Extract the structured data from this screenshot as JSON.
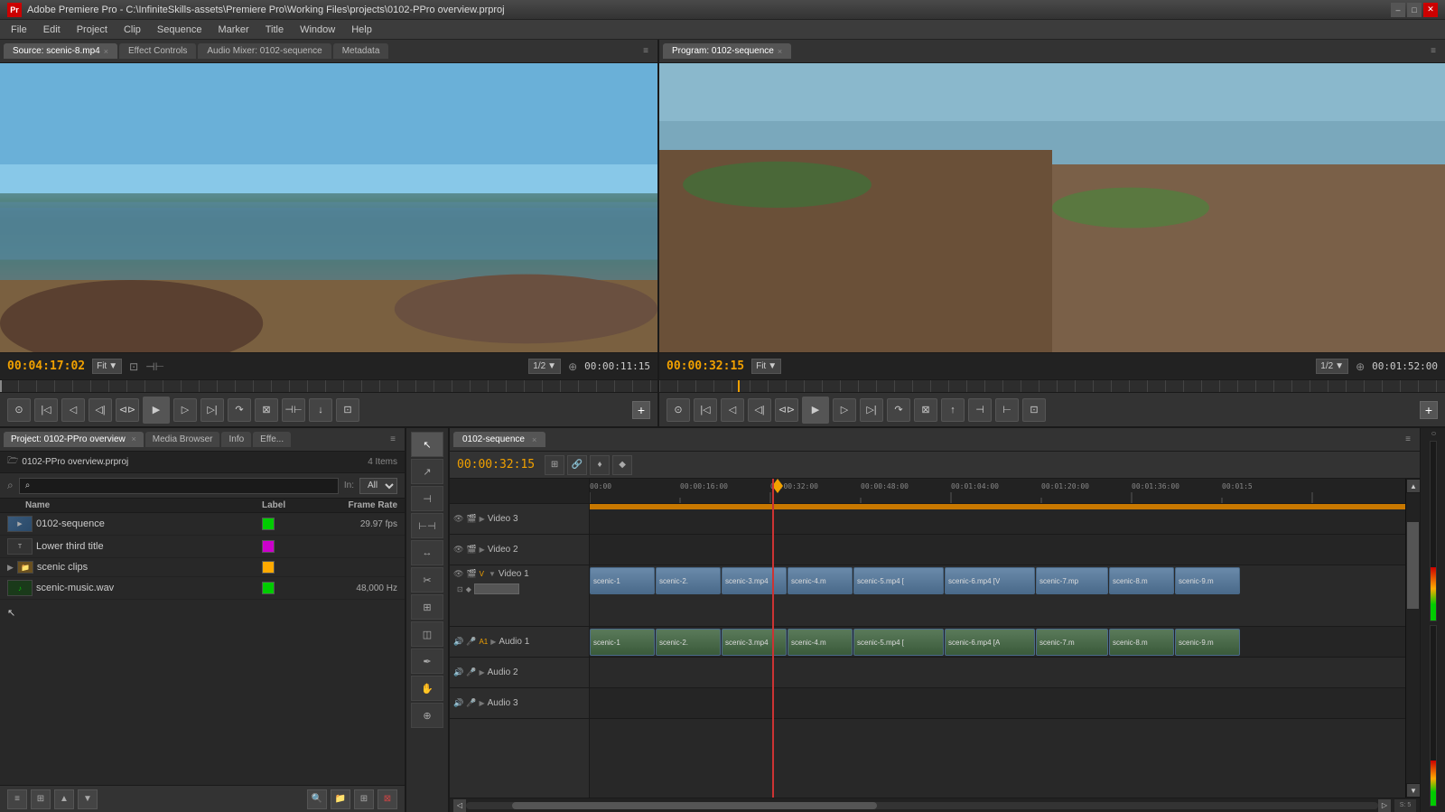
{
  "title_bar": {
    "title": "Adobe Premiere Pro - C:\\InfiniteSkills-assets\\Premiere Pro\\Working Files\\projects\\0102-PPro overview.prproj",
    "logo": "Pr",
    "minimize": "–",
    "maximize": "□",
    "close": "✕"
  },
  "menu_bar": {
    "items": [
      "File",
      "Edit",
      "Project",
      "Clip",
      "Sequence",
      "Marker",
      "Title",
      "Window",
      "Help"
    ]
  },
  "source_panel": {
    "tabs": [
      {
        "label": "Source: scenic-8.mp4",
        "active": true,
        "closable": true
      },
      {
        "label": "Effect Controls",
        "active": false
      },
      {
        "label": "Audio Mixer: 0102-sequence",
        "active": false
      },
      {
        "label": "Metadata",
        "active": false
      }
    ],
    "menu_btn": "≡",
    "timecode": "00:04:17:02",
    "fit_label": "Fit",
    "scale": "1/2",
    "timecode_right": "00:00:11:15"
  },
  "program_panel": {
    "tabs": [
      {
        "label": "Program: 0102-sequence",
        "active": true,
        "closable": true
      }
    ],
    "menu_btn": "≡",
    "timecode": "00:00:32:15",
    "fit_label": "Fit",
    "scale": "1/2",
    "timecode_right": "00:01:52:00"
  },
  "transport_source": {
    "buttons": [
      "⊲",
      "◁",
      "|◁",
      "◁|",
      "▶",
      "|▷",
      "▷|",
      "▷⊳",
      "⊳"
    ],
    "extra_left": "⊙",
    "marker": "♦",
    "camera": "⊡"
  },
  "transport_program": {
    "buttons": [
      "⊲",
      "◁",
      "|◁",
      "◁|",
      "▶",
      "|▷",
      "▷|",
      "▷⊳",
      "⊳"
    ],
    "extra_left": "⊙",
    "marker": "♦",
    "camera": "⊡"
  },
  "project_panel": {
    "tabs": [
      {
        "label": "Project: 0102-PPro overview",
        "active": true,
        "closable": true
      },
      {
        "label": "Media Browser",
        "active": false
      },
      {
        "label": "Info",
        "active": false
      },
      {
        "label": "Effe...",
        "active": false
      }
    ],
    "project_name": "0102-PPro overview.prproj",
    "item_count": "4 Items",
    "search_placeholder": "⌕",
    "in_label": "In:",
    "in_value": "All",
    "columns": {
      "name": "Name",
      "label": "Label",
      "frame_rate": "Frame Rate"
    },
    "items": [
      {
        "type": "sequence",
        "name": "0102-sequence",
        "label_color": "#00cc00",
        "frame_rate": "29.97 fps",
        "icon": "seq"
      },
      {
        "type": "title",
        "name": "Lower third title",
        "label_color": "#cc00cc",
        "frame_rate": "",
        "icon": "title"
      },
      {
        "type": "folder",
        "name": "scenic clips",
        "label_color": "#ffaa00",
        "frame_rate": "",
        "icon": "folder"
      },
      {
        "type": "audio",
        "name": "scenic-music.wav",
        "label_color": "#00cc00",
        "frame_rate": "48,000 Hz",
        "icon": "audio"
      }
    ],
    "toolbar_buttons": [
      "▤",
      "▦",
      "▲",
      "▼",
      "⊙",
      "🔍",
      "📁",
      "≡"
    ]
  },
  "tools_panel": {
    "tools": [
      {
        "name": "selection",
        "icon": "↖",
        "active": true
      },
      {
        "name": "track-select",
        "icon": "↗"
      },
      {
        "name": "ripple-edit",
        "icon": "⊣"
      },
      {
        "name": "rolling-edit",
        "icon": "⊢"
      },
      {
        "name": "rate-stretch",
        "icon": "↔"
      },
      {
        "name": "razor",
        "icon": "✂"
      },
      {
        "name": "slip",
        "icon": "◫"
      },
      {
        "name": "slide",
        "icon": "⊞"
      },
      {
        "name": "pen",
        "icon": "✏"
      },
      {
        "name": "hand",
        "icon": "✋"
      },
      {
        "name": "zoom",
        "icon": "🔍"
      }
    ]
  },
  "timeline_panel": {
    "tab_label": "0102-sequence",
    "tab_close": "×",
    "timecode": "00:00:32:15",
    "ruler_marks": [
      "00:00",
      "00:00:16:00",
      "00:00:32:00",
      "00:00:48:00",
      "00:01:04:00",
      "00:01:20:00",
      "00:01:36:00",
      "00:01:5"
    ],
    "tracks": [
      {
        "name": "Video 3",
        "type": "video",
        "visible": true,
        "locked": false
      },
      {
        "name": "Video 2",
        "type": "video",
        "visible": true,
        "locked": false
      },
      {
        "name": "Video 1",
        "type": "video",
        "visible": true,
        "locked": false
      },
      {
        "name": "Audio 1",
        "type": "audio",
        "visible": true,
        "locked": false
      },
      {
        "name": "Audio 2",
        "type": "audio",
        "visible": true,
        "locked": false
      },
      {
        "name": "Audio 3",
        "type": "audio",
        "visible": true,
        "locked": false
      }
    ],
    "video_clips": [
      "scenic-1",
      "scenic-2.",
      "scenic-3.mp4",
      "scenic-4.m",
      "scenic-5.mp4 [",
      "scenic-6.mp4 [V",
      "scenic-7.mp",
      "scenic-8.m",
      "scenic-9.m"
    ],
    "audio_clips": [
      "scenic-1",
      "scenic-2.",
      "scenic-3.mp4",
      "scenic-4.m",
      "scenic-5.mp4 [",
      "scenic-6.mp4 [A",
      "scenic-7.m",
      "scenic-8.m",
      "scenic-9.m"
    ]
  },
  "colors": {
    "accent_orange": "#f0a000",
    "accent_red": "#cc3333",
    "bg_dark": "#1a1a1a",
    "bg_panel": "#282828",
    "bg_medium": "#2d2d2d",
    "bg_light": "#333333",
    "text_primary": "#cccccc",
    "text_dim": "#888888",
    "clip_video": "#5a7a9a",
    "clip_audio": "#5a7a5a"
  }
}
